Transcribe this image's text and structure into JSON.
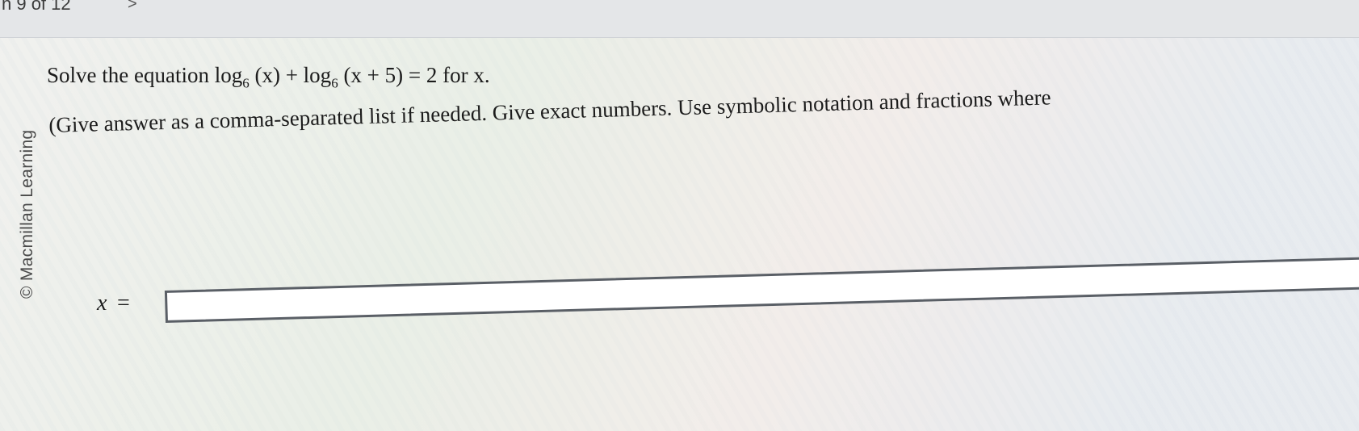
{
  "nav": {
    "counter": "n 9 of 12",
    "next_symbol": ">"
  },
  "brand": {
    "text": "© Macmillan Learning"
  },
  "question": {
    "prefix": "Solve the equation log",
    "base1": "6",
    "arg1": " (x) + log",
    "base2": "6",
    "arg2": " (x + 5) = 2 for x."
  },
  "instructions": {
    "text": "(Give answer as a comma-separated list if needed. Give exact numbers. Use symbolic notation and fractions where"
  },
  "answer": {
    "label_var": "x",
    "label_eq": "=",
    "value": ""
  },
  "colors": {
    "background": "#f1f1ef",
    "text": "#1c1c1c",
    "input_border": "#5a5f66"
  }
}
